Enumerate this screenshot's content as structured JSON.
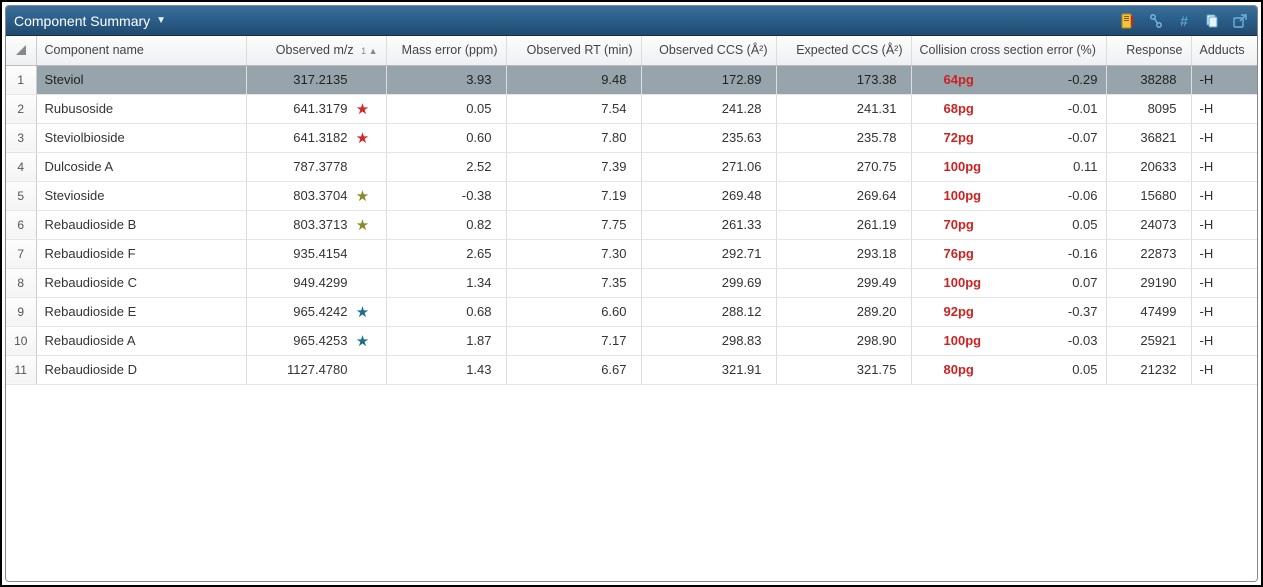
{
  "titlebar": {
    "title": "Component Summary",
    "icons": {
      "notes": "notes-icon",
      "link": "link-icon",
      "hash": "#",
      "copy": "copy-icon",
      "popout": "popout-icon"
    }
  },
  "columns": {
    "row": "",
    "name": "Component name",
    "mz": "Observed m/z",
    "mz_sort": "1 ▲",
    "merr": "Mass error (ppm)",
    "rt": "Observed RT (min)",
    "occs": "Observed CCS (Å²)",
    "eccs": "Expected CCS (Å²)",
    "ccse": "Collision cross section error (%)",
    "resp": "Response",
    "add": "Adducts"
  },
  "rows": [
    {
      "n": "1",
      "name": "Steviol",
      "mz": "317.2135",
      "star": "",
      "starClass": "",
      "merr": "3.93",
      "rt": "9.48",
      "occs": "172.89",
      "eccs": "173.38",
      "annot": "64pg",
      "ccse": "-0.29",
      "resp": "38288",
      "add": "-H",
      "selected": true
    },
    {
      "n": "2",
      "name": "Rubusoside",
      "mz": "641.3179",
      "star": "★",
      "starClass": "star-red",
      "merr": "0.05",
      "rt": "7.54",
      "occs": "241.28",
      "eccs": "241.31",
      "annot": "68pg",
      "ccse": "-0.01",
      "resp": "8095",
      "add": "-H"
    },
    {
      "n": "3",
      "name": "Steviolbioside",
      "mz": "641.3182",
      "star": "★",
      "starClass": "star-red",
      "merr": "0.60",
      "rt": "7.80",
      "occs": "235.63",
      "eccs": "235.78",
      "annot": "72pg",
      "ccse": "-0.07",
      "resp": "36821",
      "add": "-H"
    },
    {
      "n": "4",
      "name": "Dulcoside A",
      "mz": "787.3778",
      "star": "",
      "starClass": "",
      "merr": "2.52",
      "rt": "7.39",
      "occs": "271.06",
      "eccs": "270.75",
      "annot": "100pg",
      "ccse": "0.11",
      "resp": "20633",
      "add": "-H"
    },
    {
      "n": "5",
      "name": "Stevioside",
      "mz": "803.3704",
      "star": "★",
      "starClass": "star-olive",
      "merr": "-0.38",
      "rt": "7.19",
      "occs": "269.48",
      "eccs": "269.64",
      "annot": "100pg",
      "ccse": "-0.06",
      "resp": "15680",
      "add": "-H"
    },
    {
      "n": "6",
      "name": "Rebaudioside B",
      "mz": "803.3713",
      "star": "★",
      "starClass": "star-olive",
      "merr": "0.82",
      "rt": "7.75",
      "occs": "261.33",
      "eccs": "261.19",
      "annot": "70pg",
      "ccse": "0.05",
      "resp": "24073",
      "add": "-H"
    },
    {
      "n": "7",
      "name": "Rebaudioside F",
      "mz": "935.4154",
      "star": "",
      "starClass": "",
      "merr": "2.65",
      "rt": "7.30",
      "occs": "292.71",
      "eccs": "293.18",
      "annot": "76pg",
      "ccse": "-0.16",
      "resp": "22873",
      "add": "-H"
    },
    {
      "n": "8",
      "name": "Rebaudioside C",
      "mz": "949.4299",
      "star": "",
      "starClass": "",
      "merr": "1.34",
      "rt": "7.35",
      "occs": "299.69",
      "eccs": "299.49",
      "annot": "100pg",
      "ccse": "0.07",
      "resp": "29190",
      "add": "-H"
    },
    {
      "n": "9",
      "name": "Rebaudioside E",
      "mz": "965.4242",
      "star": "★",
      "starClass": "star-teal",
      "merr": "0.68",
      "rt": "6.60",
      "occs": "288.12",
      "eccs": "289.20",
      "annot": "92pg",
      "ccse": "-0.37",
      "resp": "47499",
      "add": "-H"
    },
    {
      "n": "10",
      "name": "Rebaudioside A",
      "mz": "965.4253",
      "star": "★",
      "starClass": "star-teal",
      "merr": "1.87",
      "rt": "7.17",
      "occs": "298.83",
      "eccs": "298.90",
      "annot": "100pg",
      "ccse": "-0.03",
      "resp": "25921",
      "add": "-H"
    },
    {
      "n": "11",
      "name": "Rebaudioside D",
      "mz": "1127.4780",
      "star": "",
      "starClass": "",
      "merr": "1.43",
      "rt": "6.67",
      "occs": "321.91",
      "eccs": "321.75",
      "annot": "80pg",
      "ccse": "0.05",
      "resp": "21232",
      "add": "-H"
    }
  ]
}
